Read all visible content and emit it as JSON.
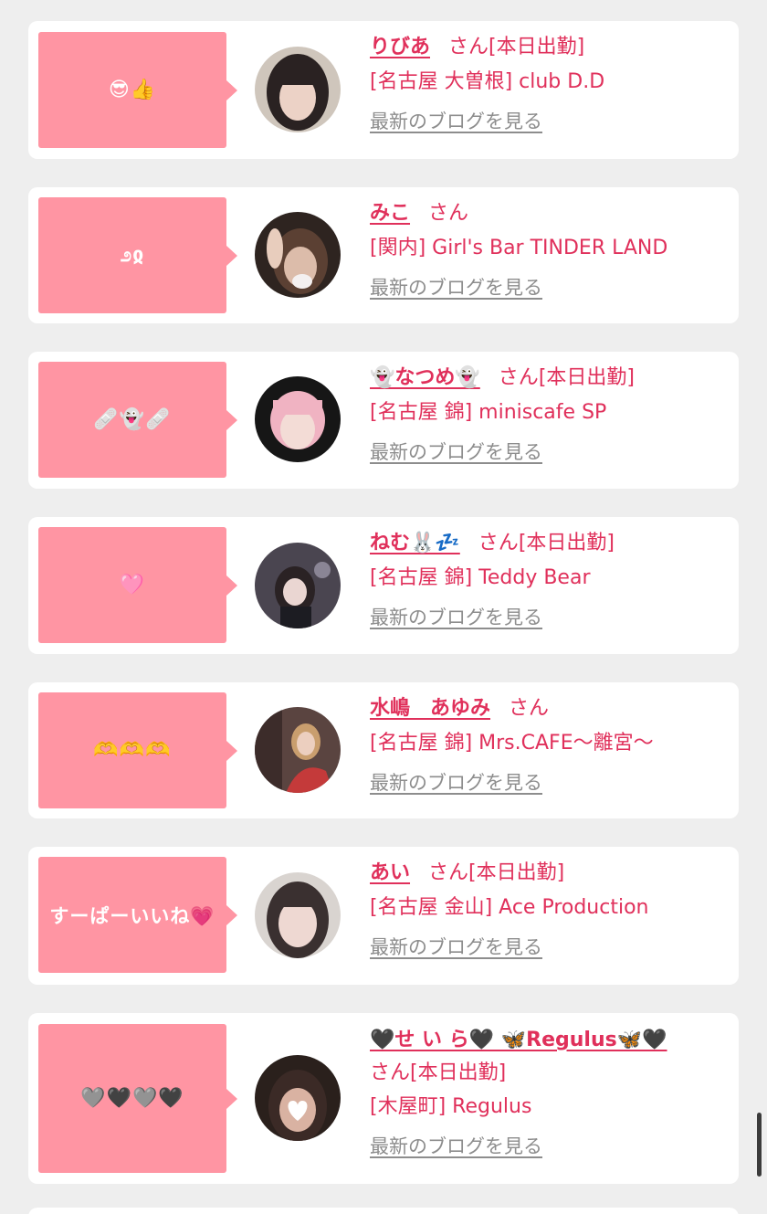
{
  "blog_link_label": "最新のブログを見る",
  "colors": {
    "bubble": "#ff95a3",
    "accent": "#e0305b",
    "link_gray": "#8d8d8d",
    "background": "#eeeeee"
  },
  "cards": [
    {
      "comment": "😎👍",
      "name": "りびあ",
      "suffix": "さん",
      "status": "[本日出勤]",
      "shop": "[名古屋 大曽根] club D.D",
      "avatar_colors": [
        "#2a2222",
        "#e9cfc4"
      ]
    },
    {
      "comment": "೨ჲ",
      "name": "みこ",
      "suffix": "さん",
      "status": "",
      "shop": "[関内] Girl's Bar TINDER LAND",
      "avatar_colors": [
        "#5b4033",
        "#d8b6a4"
      ]
    },
    {
      "comment": "🩹👻🩹",
      "name": "👻なつめ👻",
      "suffix": "さん",
      "status": "[本日出勤]",
      "shop": "[名古屋 錦] miniscafe SP",
      "avatar_colors": [
        "#1b1b1b",
        "#f2b8c4"
      ]
    },
    {
      "comment": "🩷",
      "name": "ねむ🐰💤",
      "suffix": "さん",
      "status": "[本日出勤]",
      "shop": "[名古屋 錦] Teddy Bear",
      "avatar_colors": [
        "#3a3540",
        "#d9c9d4"
      ]
    },
    {
      "comment": "🫶🫶🫶",
      "name": "水嶋　あゆみ",
      "suffix": "さん",
      "status": "",
      "shop": "[名古屋 錦] Mrs.CAFE～離宮～",
      "avatar_colors": [
        "#4b3030",
        "#c43a3a"
      ]
    },
    {
      "comment": "すーぱーいいね💗",
      "name": "あい",
      "suffix": "さん",
      "status": "[本日出勤]",
      "shop": "[名古屋 金山] Ace Production",
      "avatar_colors": [
        "#3a3030",
        "#e8d2cc"
      ]
    },
    {
      "comment": "🩶🖤🩶🖤",
      "name": "🖤せ い ら🖤 🦋Regulus🦋🖤",
      "suffix": "さん",
      "status": "[本日出勤]",
      "shop": "[木屋町] Regulus",
      "avatar_colors": [
        "#3b2a26",
        "#cfa99a"
      ]
    }
  ]
}
